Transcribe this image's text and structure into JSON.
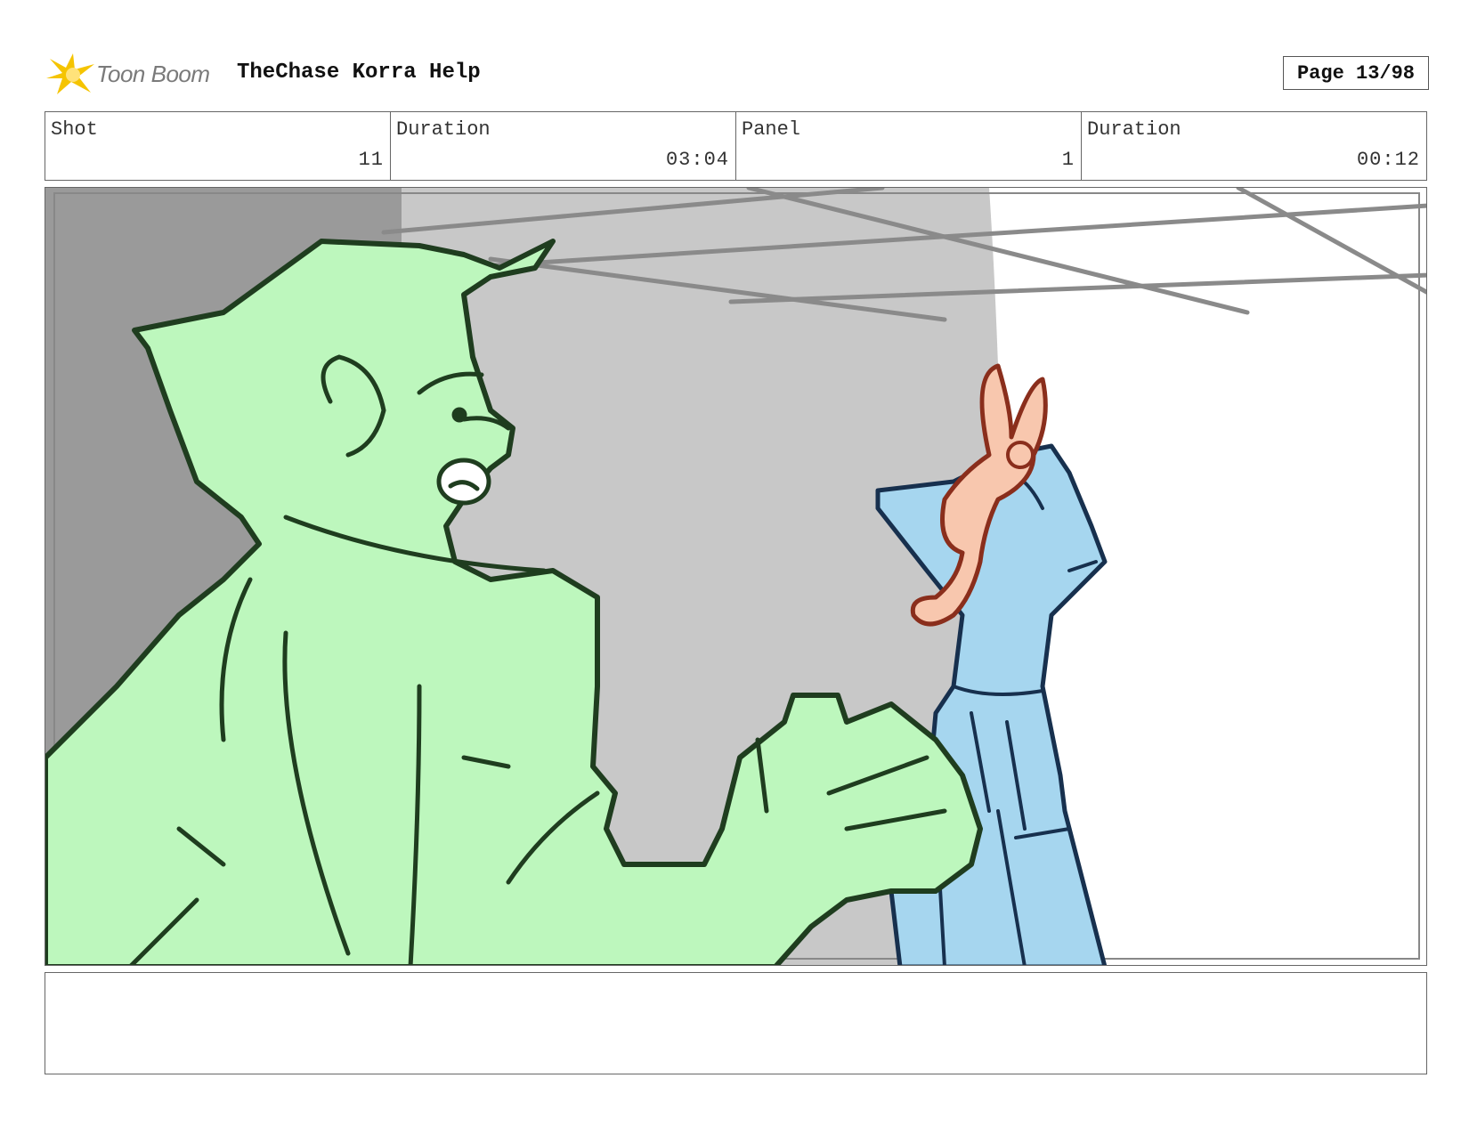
{
  "header": {
    "logo_text": "Toon Boom",
    "logo_icon": "toon-boom-star-icon",
    "project_title": "TheChase Korra Help",
    "page_label": "Page 13/98"
  },
  "info": [
    {
      "label": "Shot",
      "value": "11"
    },
    {
      "label": "Duration",
      "value": "03:04"
    },
    {
      "label": "Panel",
      "value": "1"
    },
    {
      "label": "Duration",
      "value": "00:12"
    }
  ],
  "colors": {
    "frame_border": "#666666",
    "left_wall": "#9a9a9a",
    "back_wall": "#c8c8c8",
    "figure_green_fill": "#bdf7bd",
    "figure_green_line": "#1f3d1f",
    "figure_blue_fill": "#a6d6ef",
    "figure_blue_line": "#17304e",
    "creature_fill": "#f8c7ae",
    "creature_line": "#8a2e1c",
    "logo_star": "#f5c400"
  },
  "notes": {
    "text": ""
  }
}
